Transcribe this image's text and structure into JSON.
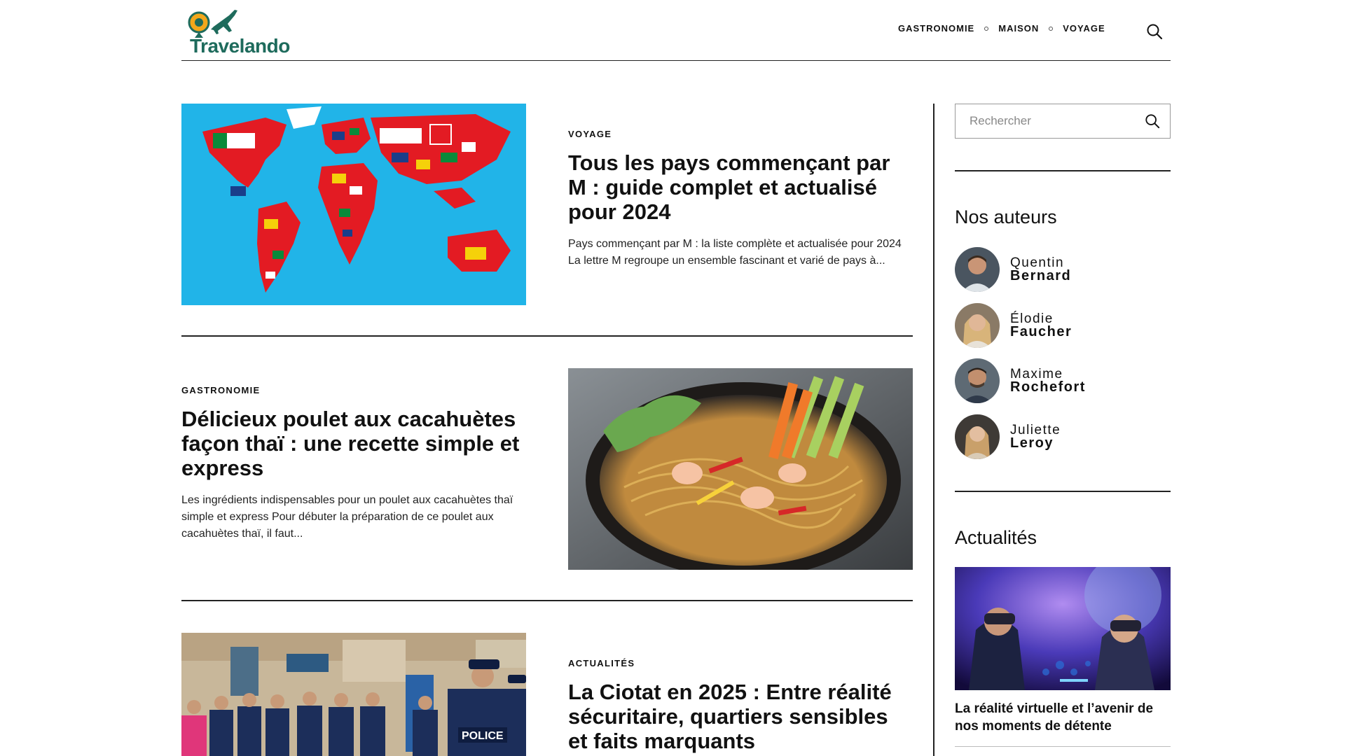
{
  "site": {
    "logo_text": "Travelando",
    "brand_color": "#1e6b5c"
  },
  "nav": {
    "items": [
      {
        "label": "GASTRONOMIE"
      },
      {
        "label": "MAISON"
      },
      {
        "label": "VOYAGE"
      }
    ]
  },
  "articles": [
    {
      "category": "VOYAGE",
      "title": "Tous les pays commençant par M : guide complet et actualisé pour 2024",
      "excerpt": "Pays commençant par M : la liste complète et actualisée pour 2024 La lettre M regroupe un ensemble fascinant et varié de pays à...",
      "image": "world-map-flags"
    },
    {
      "category": "GASTRONOMIE",
      "title": "Délicieux poulet aux cacahuètes façon thaï : une recette simple et express",
      "excerpt": "Les ingrédients indispensables pour un poulet aux cacahuètes thaï simple et express Pour débuter la préparation de ce poulet aux cacahuètes thaï, il faut...",
      "image": "thai-noodle-bowl"
    },
    {
      "category": "ACTUALITÉS",
      "title": "La Ciotat en 2025 : Entre réalité sécuritaire, quartiers sensibles et faits marquants",
      "excerpt": "",
      "image": "police-street"
    }
  ],
  "sidebar": {
    "search_placeholder": "Rechercher",
    "authors_heading": "Nos auteurs",
    "authors": [
      {
        "first": "Quentin",
        "last": "Bernard"
      },
      {
        "first": "Élodie",
        "last": "Faucher"
      },
      {
        "first": "Maxime",
        "last": "Rochefort"
      },
      {
        "first": "Juliette",
        "last": "Leroy"
      }
    ],
    "news_heading": "Actualités",
    "news_item": {
      "title": "La réalité virtuelle et l’avenir de nos moments de détente",
      "image": "vr-headsets"
    }
  }
}
